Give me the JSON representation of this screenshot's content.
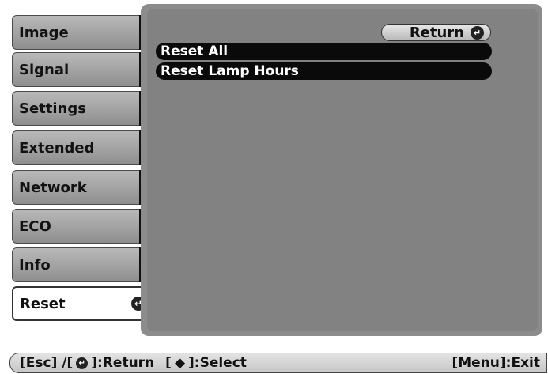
{
  "sidebar": {
    "items": [
      {
        "label": "Image"
      },
      {
        "label": "Signal"
      },
      {
        "label": "Settings"
      },
      {
        "label": "Extended"
      },
      {
        "label": "Network"
      },
      {
        "label": "ECO"
      },
      {
        "label": "Info"
      },
      {
        "label": "Reset",
        "active": true
      }
    ]
  },
  "main": {
    "return_label": "Return",
    "items": [
      {
        "label": "Reset All"
      },
      {
        "label": "Reset Lamp Hours"
      }
    ]
  },
  "footer": {
    "esc": "[Esc] /[",
    "return": "]:Return",
    "select_open": "[",
    "select": "]:Select",
    "menu_exit": "[Menu]:Exit"
  },
  "icons": {
    "enter": "enter-icon",
    "updown": "up-down-arrow-icon"
  }
}
